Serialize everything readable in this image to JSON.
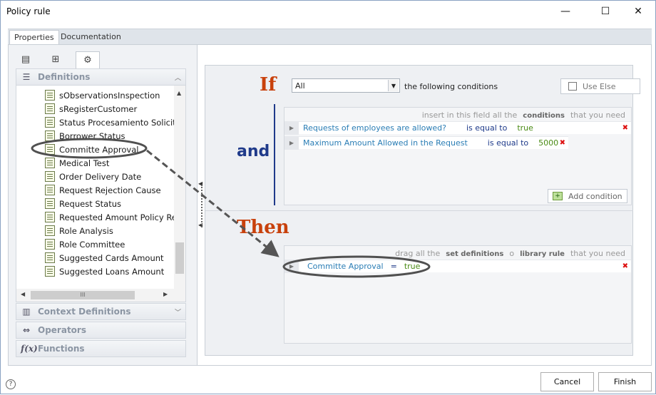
{
  "window": {
    "title": "Policy rule",
    "minimize": "—",
    "maximize": "☐",
    "close": "✕"
  },
  "tabs": [
    {
      "label": "Properties"
    },
    {
      "label": "Documentation"
    }
  ],
  "left": {
    "sections": {
      "definitions": "Definitions",
      "context": "Context Definitions",
      "operators": "Operators",
      "functions": "Functions"
    },
    "items": [
      "sObservationsInspection",
      "sRegisterCustomer",
      "Status Procesamiento Solicitud",
      "Borrower Status",
      "Committe Approval",
      "Medical Test",
      "Order Delivery Date",
      "Request Rejection Cause",
      "Request Status",
      "Requested Amount Policy Result",
      "Role Analysis",
      "Role Committee",
      "Suggested Cards Amount",
      "Suggested Loans Amount"
    ],
    "hscroll_glyph": "III"
  },
  "rule": {
    "if_label": "If",
    "and_label": "and",
    "then_label": "Then",
    "match_select": "All",
    "following_text": "the following conditions",
    "use_else_label": "Use Else",
    "cond_hint_pre": "insert in this field all the",
    "cond_hint_bold": "conditions",
    "cond_hint_post": "that you need",
    "conditions": [
      {
        "field": "Requests of employees are allowed?",
        "op": "is equal to",
        "value": "true"
      },
      {
        "field": "Maximum Amount Allowed in the Request",
        "op": "is equal to",
        "value": "5000"
      }
    ],
    "add_condition": "Add condition",
    "then_hint_pre": "drag all the",
    "then_hint_bold1": "set definitions",
    "then_hint_mid": "o",
    "then_hint_bold2": "library rule",
    "then_hint_post": "that you need",
    "action": {
      "field": "Committe Approval",
      "op": "=",
      "value": "true"
    }
  },
  "footer": {
    "cancel": "Cancel",
    "finish": "Finish",
    "help": "?"
  }
}
